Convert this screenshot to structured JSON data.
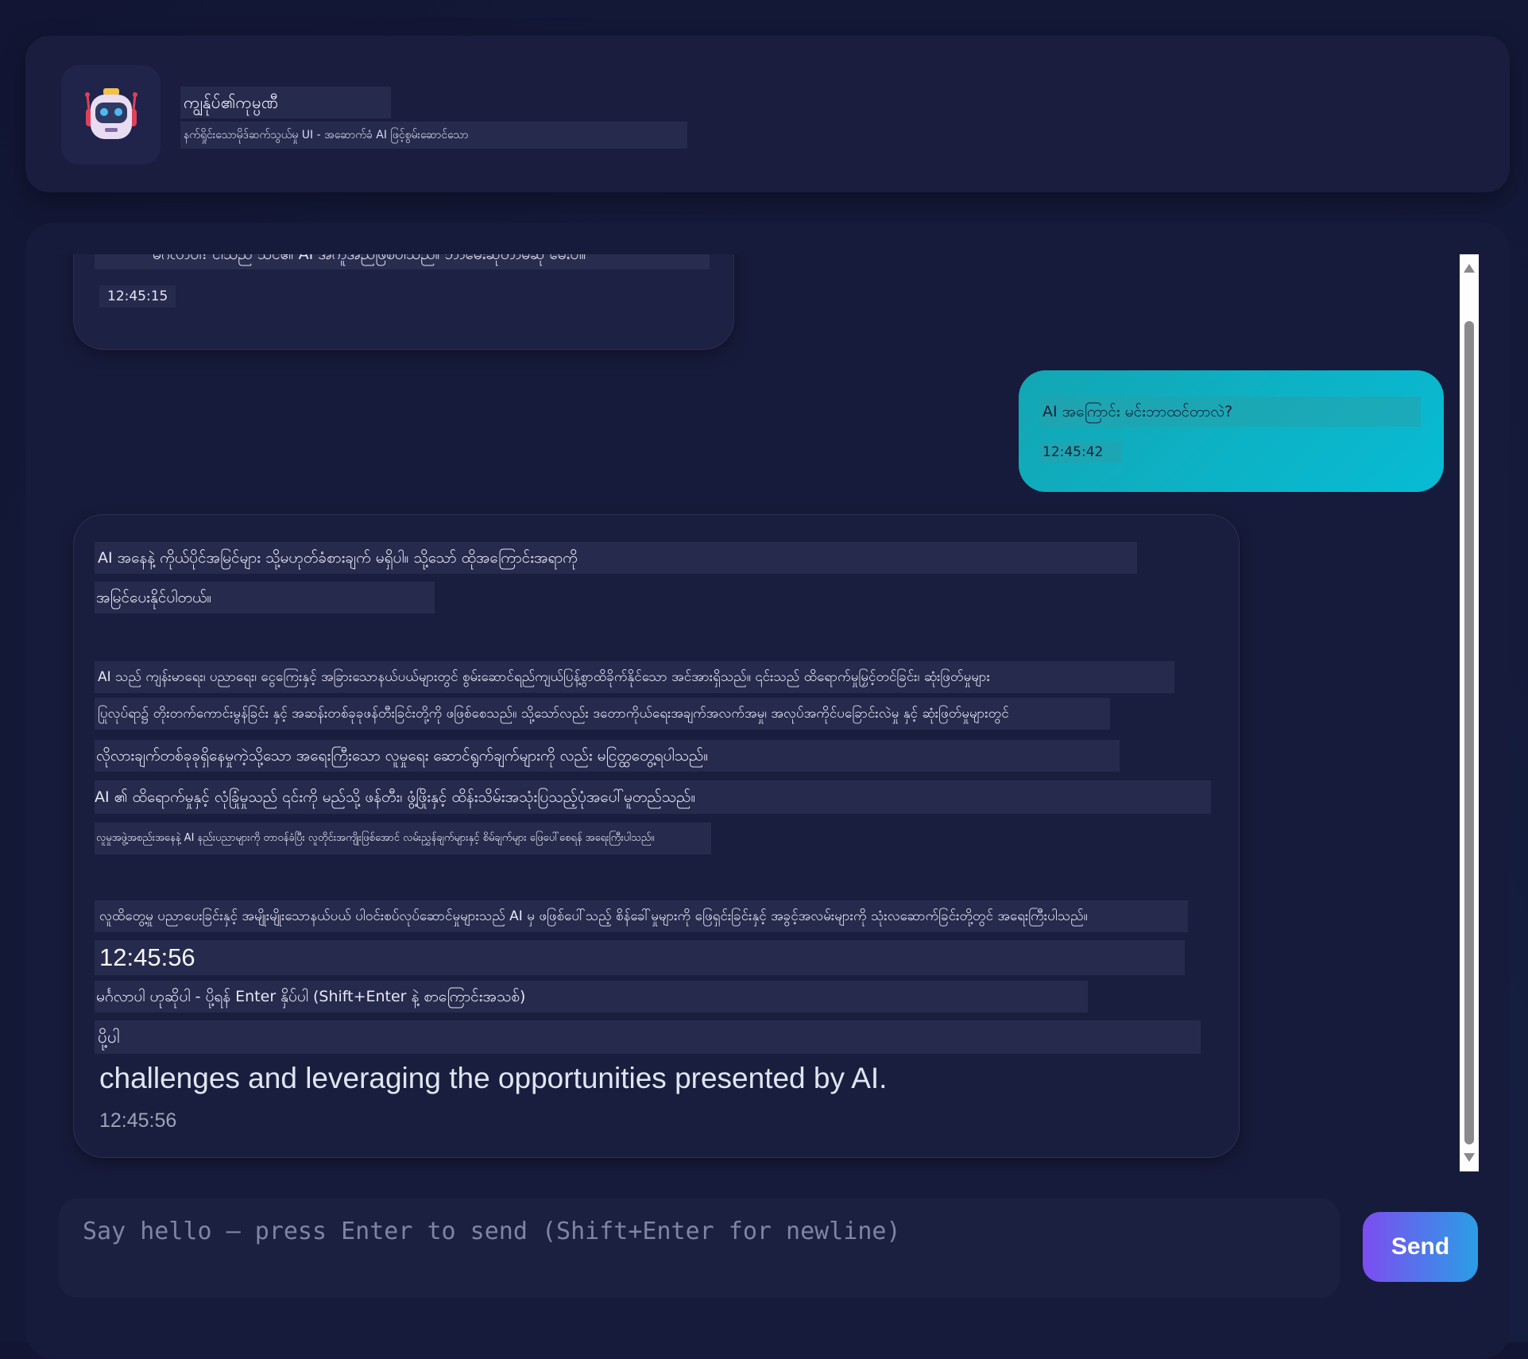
{
  "header": {
    "avatar_icon": "robot-icon",
    "title": "ကျွန်ုပ်၏ကုမ္ပဏီ",
    "subtitle": "နက်ရှိုင်းသောမိုဒ်ဆက်သွယ်မှု UI - အဆောက်ခံ AI ဖြင့်စွမ်းဆောင်သော"
  },
  "messages": [
    {
      "role": "bot",
      "text": "မင်္ဂလာပါ! ငါသည် သင်၏ AI အကူအညီဖြစ်ပါသည်။ ဘာမေးဆိုတာမဆို မေးပါ။",
      "time": "12:45:15"
    },
    {
      "role": "user",
      "text": "AI အကြောင်း မင်းဘာထင်တာလဲ?",
      "time": "12:45:42"
    },
    {
      "role": "bot",
      "lines": [
        "AI အနေနဲ့ ကိုယ်ပိုင်အမြင်များ သို့မဟုတ်ခံစားချက် မရှိပါ။ သို့သော် ထိုအကြောင်းအရာကို",
        "အမြင်ပေးနိုင်ပါတယ်။",
        "AI သည် ကျန်းမာရေး၊ ပညာရေး၊ ငွေကြေးနှင့် အခြားသောနယ်ပယ်များတွင် စွမ်းဆောင်ရည်ကျယ်ပြန့်စွာထိခိုက်နိုင်သော အင်အားရှိသည်။ ၎င်းသည် ထိရောက်မှုမြှင့်တင်ခြင်း၊ ဆုံးဖြတ်မှုများ",
        "ပြုလုပ်ရာ၌ တိုးတက်ကောင်းမွန်ခြင်း နှင့် အဆန်းတစ်ခုခုဖန်တီးခြင်းတို့ကို ဖဖြစ်စေသည်။ သို့သော်လည်း ဒတောကိုယ်ရေးအချက်အလက်အမှု၊ အလုပ်အကိုင်ပခြောင်းလဲမှု နှင့် ဆုံးဖြတ်မှုများတွင်",
        "လိုလားချက်တစ်ခုခုရှိနေမှုကဲ့သို့သော အရေးကြီးသော လူမှုရေး ဆောင်ရွက်ချက်များကို လည်း မငြတ္ထတွေ့ရပါသည်။",
        "AI ၏ ထိရောက်မှုနှင့် လုံခြုံမှုသည် ၎င်းကို မည်သို့ ဖန်တီး၊ ဖွံ့ဖြိုးနှင့် ထိန်းသိမ်းအသုံးပြသည့်ပုံအပေါ်မူတည်သည်။",
        "လူမှုအဖွဲ့အစည်းအနေနဲ့ AI နည်းပညာများကို တာဝန်ခံပြီး လူတိုင်းအကျိုးဖြစ်အောင် လမ်းညွှန်ချက်များနှင့် စိမ်ချက်များ ဖြေပေါ်စေရန် အရေးကြီးပါသည်။",
        "လူထိတွေ့မှု ပညာပေးခြင်းနှင့် အမျိုးမျိုးသောနယ်ပယ် ပါဝင်းစပ်လုပ်ဆောင်မှုများသည် AI မှ ဖဖြစ်ပေါ်သည့် စိန်ခေါ်မှုများကို ဖြေရှင်းခြင်းနှင့် အခွင့်အလမ်းများကို သုံးလဆောက်ခြင်းတို့တွင် အရေးကြီးပါသည်။"
      ],
      "inner_time": "12:45:56",
      "inner_placeholder": "မင်္ဂလာပါ ဟုဆိုပါ - ပို့ရန် Enter နှိပ်ပါ (Shift+Enter နဲ့ စာကြောင်းအသစ်)",
      "inner_send": "ပို့ပါ",
      "closing": "challenges and leveraging the opportunities presented by AI.",
      "time": "12:45:56"
    }
  ],
  "input": {
    "placeholder": "Say hello — press Enter to send (Shift+Enter for newline)"
  },
  "send_label": "Send",
  "colors": {
    "background": "#121634",
    "panel": "#1a1d3d",
    "user_bubble": "#07bcd4",
    "send_gradient_start": "#7c4df0",
    "send_gradient_end": "#2a9ee6"
  }
}
